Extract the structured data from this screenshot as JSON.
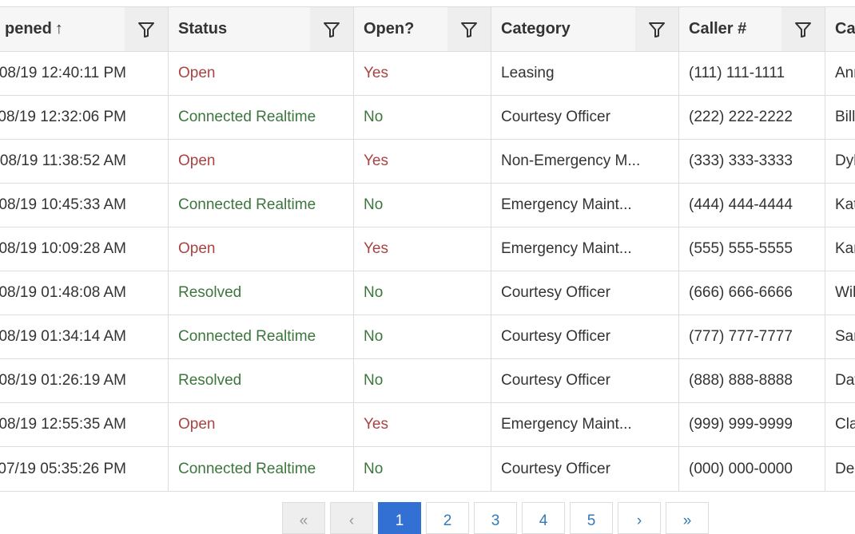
{
  "columns": [
    {
      "label": "pened",
      "sort_icon": "↑",
      "filter_icon": "filter-icon"
    },
    {
      "label": "Status",
      "filter_icon": "filter-icon"
    },
    {
      "label": "Open?",
      "filter_icon": "filter-icon"
    },
    {
      "label": "Category",
      "filter_icon": "filter-icon"
    },
    {
      "label": "Caller #",
      "filter_icon": "filter-icon"
    },
    {
      "label": "Ca"
    }
  ],
  "colors": {
    "open_red": "#a94442",
    "closed_green": "#3c763d",
    "active_page": "#3370d4",
    "header_bg": "#f6f6f6"
  },
  "rows": [
    {
      "opened": "08/19 12:40:11 PM",
      "status": "Open",
      "open": "Yes",
      "category": "Leasing",
      "caller": "(111) 111-1111",
      "name": "Ann"
    },
    {
      "opened": "08/19 12:32:06 PM",
      "status": "Connected Realtime",
      "open": "No",
      "category": "Courtesy Officer",
      "caller": "(222) 222-2222",
      "name": "Bill"
    },
    {
      "opened": "08/19 11:38:52 AM",
      "status": "Open",
      "open": "Yes",
      "category": "Non-Emergency M...",
      "caller": "(333) 333-3333",
      "name": "Dyl"
    },
    {
      "opened": "08/19 10:45:33 AM",
      "status": "Connected Realtime",
      "open": "No",
      "category": "Emergency Maint...",
      "caller": "(444) 444-4444",
      "name": "Kat"
    },
    {
      "opened": "08/19 10:09:28 AM",
      "status": "Open",
      "open": "Yes",
      "category": "Emergency Maint...",
      "caller": "(555) 555-5555",
      "name": "Kar"
    },
    {
      "opened": "08/19 01:48:08 AM",
      "status": "Resolved",
      "open": "No",
      "category": "Courtesy Officer",
      "caller": "(666) 666-6666",
      "name": "Wil"
    },
    {
      "opened": "08/19 01:34:14 AM",
      "status": "Connected Realtime",
      "open": "No",
      "category": "Courtesy Officer",
      "caller": "(777) 777-7777",
      "name": "Sar"
    },
    {
      "opened": "08/19 01:26:19 AM",
      "status": "Resolved",
      "open": "No",
      "category": "Courtesy Officer",
      "caller": "(888) 888-8888",
      "name": "Dav"
    },
    {
      "opened": "08/19 12:55:35 AM",
      "status": "Open",
      "open": "Yes",
      "category": "Emergency Maint...",
      "caller": "(999) 999-9999",
      "name": "Cla"
    },
    {
      "opened": "07/19 05:35:26 PM",
      "status": "Connected Realtime",
      "open": "No",
      "category": "Courtesy Officer",
      "caller": "(000) 000-0000",
      "name": "De"
    }
  ],
  "pagination": {
    "first": "«",
    "prev": "‹",
    "pages": [
      "1",
      "2",
      "3",
      "4",
      "5"
    ],
    "current": "1",
    "next": "›",
    "last": "»"
  }
}
